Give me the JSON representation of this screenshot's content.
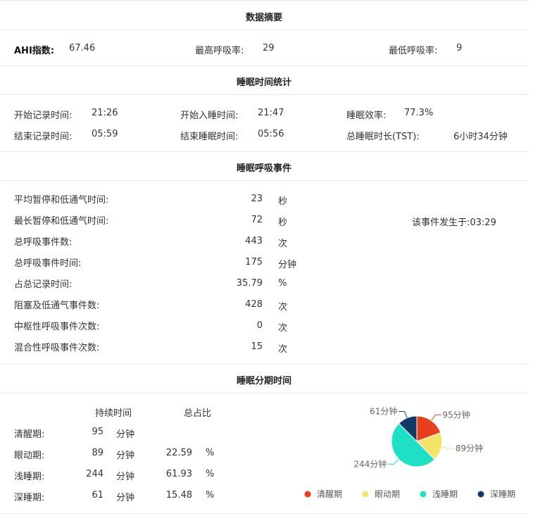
{
  "summary": {
    "title": "数据摘要",
    "ahi_label": "AHI指数:",
    "ahi_value": "67.46",
    "max_resp_label": "最高呼吸率:",
    "max_resp_value": "29",
    "min_resp_label": "最低呼吸率:",
    "min_resp_value": "9"
  },
  "sleep_time": {
    "title": "睡眠时间统计",
    "start_record_label": "开始记录时间:",
    "start_record_value": "21:26",
    "start_sleep_label": "开始入睡时间:",
    "start_sleep_value": "21:47",
    "efficiency_label": "睡眠效率:",
    "efficiency_value": "77.3%",
    "end_record_label": "结束记录时间:",
    "end_record_value": "05:59",
    "end_sleep_label": "结束睡眠时间:",
    "end_sleep_value": "05:56",
    "tst_label": "总睡眠时长(TST):",
    "tst_value": "6小时34分钟"
  },
  "events": {
    "title": "睡眠呼吸事件",
    "rows": [
      {
        "label": "平均暂停和低通气时间:",
        "value": "23",
        "unit": "秒"
      },
      {
        "label": "最长暂停和低通气时间:",
        "value": "72",
        "unit": "秒"
      },
      {
        "label": "总呼吸事件数:",
        "value": "443",
        "unit": "次"
      },
      {
        "label": "总呼吸事件时间:",
        "value": "175",
        "unit": "分钟"
      },
      {
        "label": "占总记录时间:",
        "value": "35.79",
        "unit": "%"
      },
      {
        "label": "阻塞及低通气事件数:",
        "value": "428",
        "unit": "次"
      },
      {
        "label": "中枢性呼吸事件次数:",
        "value": "0",
        "unit": "次"
      },
      {
        "label": "混合性呼吸事件次数:",
        "value": "15",
        "unit": "次"
      }
    ],
    "occurrence_text": "该事件发生于:03:29"
  },
  "stages": {
    "title": "睡眠分期时间",
    "col_duration": "持续时间",
    "col_ratio": "总占比",
    "rows": [
      {
        "name": "清醒期:",
        "minutes": "95",
        "unit": "分钟",
        "ratio": "",
        "pct": ""
      },
      {
        "name": "眼动期:",
        "minutes": "89",
        "unit": "分钟",
        "ratio": "22.59",
        "pct": "%"
      },
      {
        "name": "浅睡期:",
        "minutes": "244",
        "unit": "分钟",
        "ratio": "61.93",
        "pct": "%"
      },
      {
        "name": "深睡期:",
        "minutes": "61",
        "unit": "分钟",
        "ratio": "15.48",
        "pct": "%"
      }
    ]
  },
  "chart_data": {
    "type": "pie",
    "series": [
      {
        "name": "清醒期",
        "value": 95,
        "label": "95分钟",
        "color": "#e8401c"
      },
      {
        "name": "眼动期",
        "value": 89,
        "label": "89分钟",
        "color": "#f4e46a"
      },
      {
        "name": "浅睡期",
        "value": 244,
        "label": "244分钟",
        "color": "#1de0c5"
      },
      {
        "name": "深睡期",
        "value": 61,
        "label": "61分钟",
        "color": "#0f3a66"
      }
    ],
    "legend_position": "bottom"
  }
}
